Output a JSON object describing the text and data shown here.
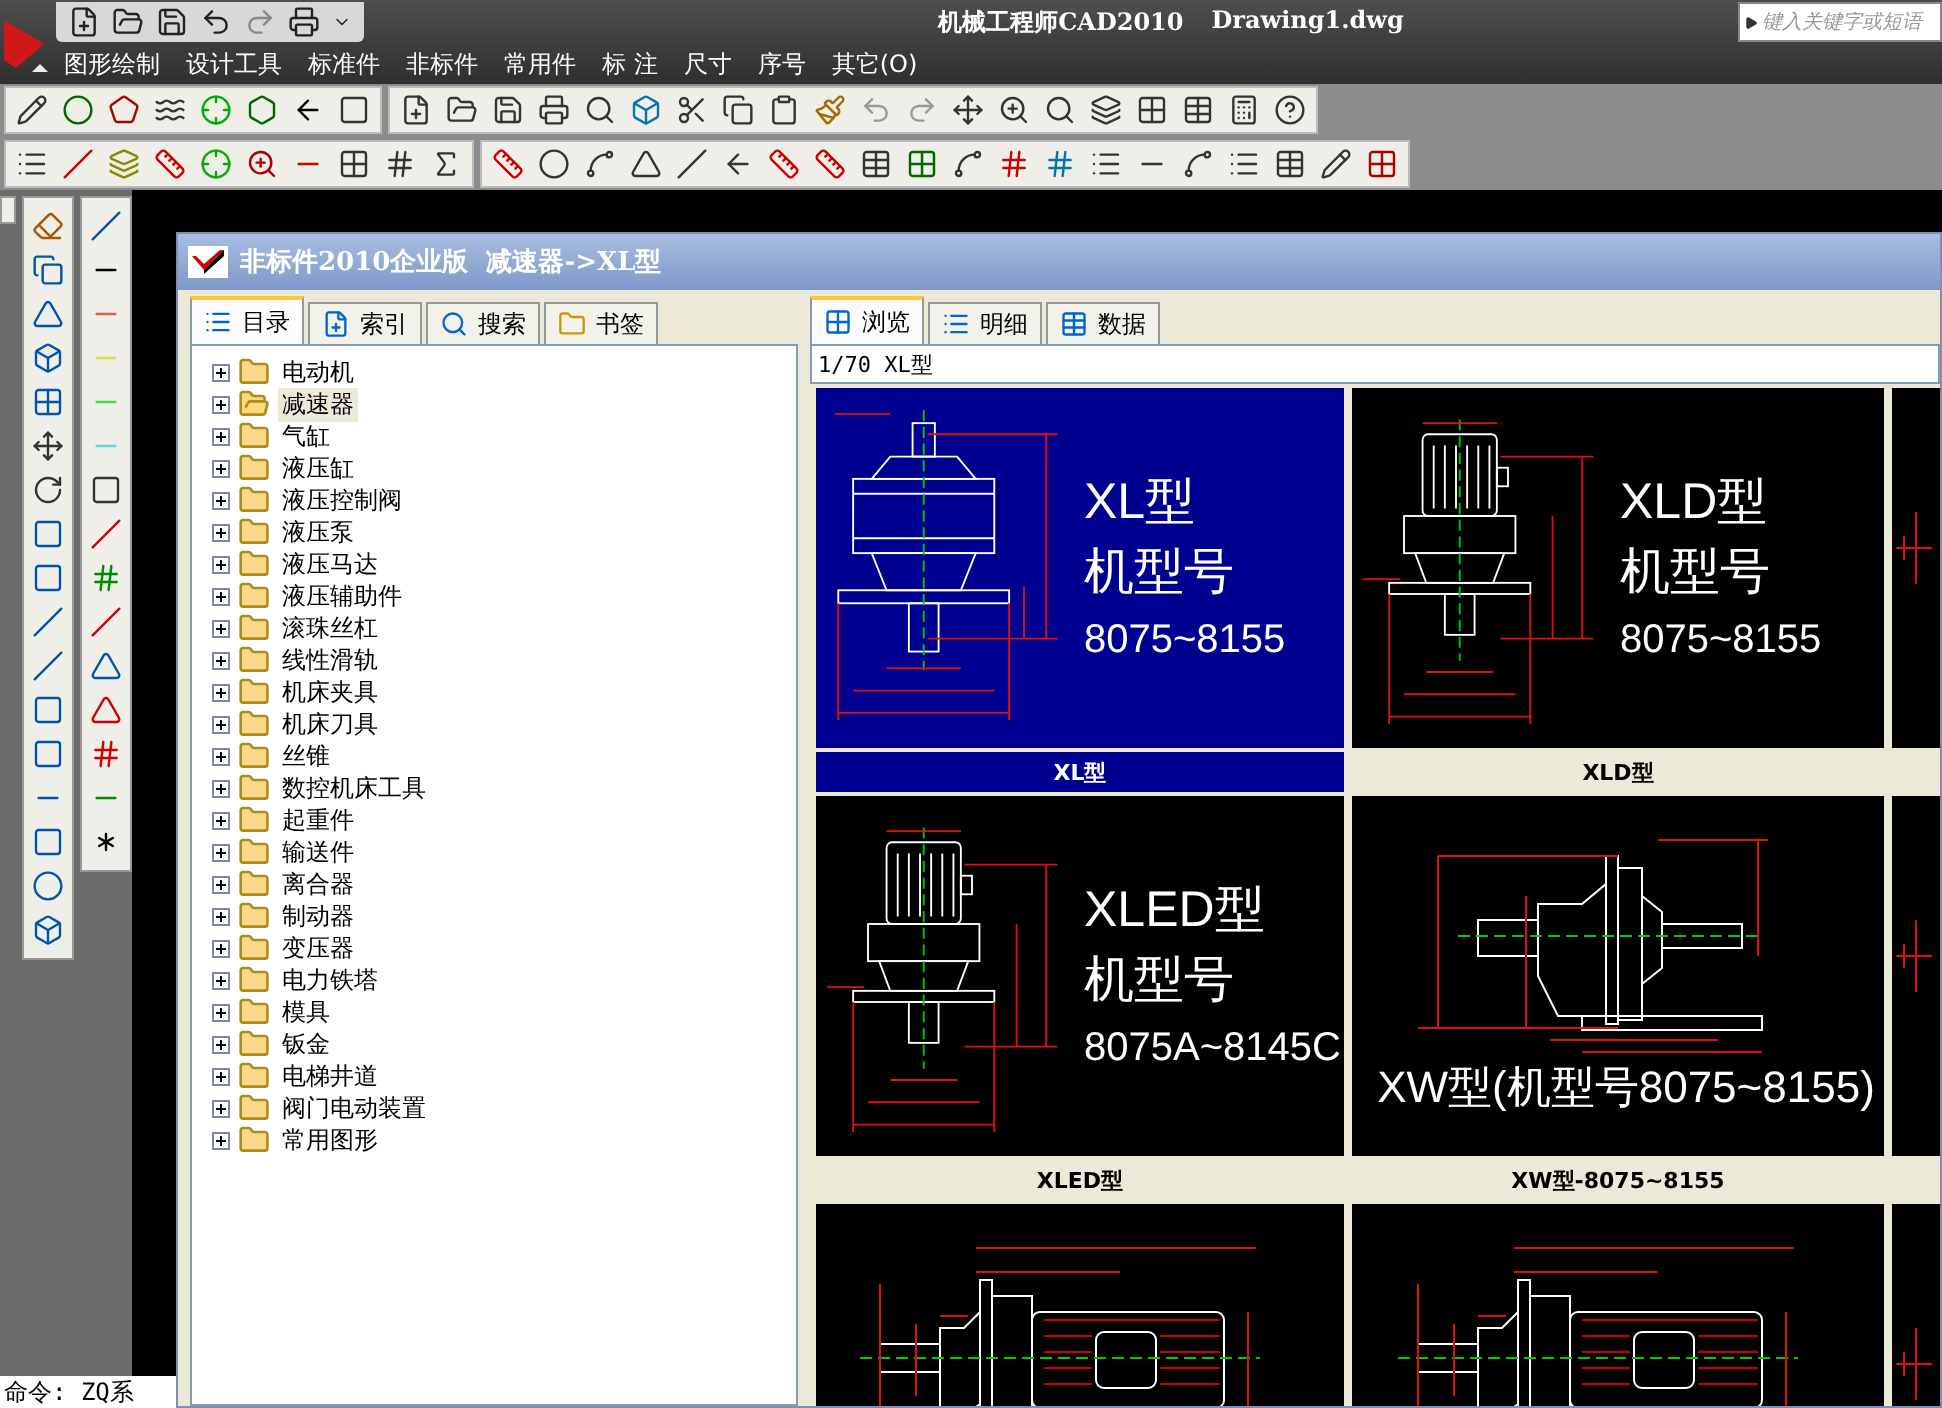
{
  "app": {
    "title": "机械工程师CAD2010",
    "document": "Drawing1.dwg",
    "search": {
      "placeholder": "键入关键字或短语"
    }
  },
  "menu": [
    "图形绘制",
    "设计工具",
    "标准件",
    "非标件",
    "常用件",
    "标 注",
    "尺寸",
    "序号",
    "其它(O)"
  ],
  "command_line": "命令: ZQ系",
  "dialog": {
    "title": "非标件2010企业版  减速器->XL型",
    "left_tabs": [
      {
        "label": "目录",
        "selected": true
      },
      {
        "label": "索引",
        "selected": false
      },
      {
        "label": "搜索",
        "selected": false
      },
      {
        "label": "书签",
        "selected": false
      }
    ],
    "tree": [
      {
        "label": "电动机",
        "selected": false
      },
      {
        "label": "减速器",
        "selected": true
      },
      {
        "label": "气缸",
        "selected": false
      },
      {
        "label": "液压缸",
        "selected": false
      },
      {
        "label": "液压控制阀",
        "selected": false
      },
      {
        "label": "液压泵",
        "selected": false
      },
      {
        "label": "液压马达",
        "selected": false
      },
      {
        "label": "液压辅助件",
        "selected": false
      },
      {
        "label": "滚珠丝杠",
        "selected": false
      },
      {
        "label": "线性滑轨",
        "selected": false
      },
      {
        "label": "机床夹具",
        "selected": false
      },
      {
        "label": "机床刀具",
        "selected": false
      },
      {
        "label": "丝锥",
        "selected": false
      },
      {
        "label": "数控机床工具",
        "selected": false
      },
      {
        "label": "起重件",
        "selected": false
      },
      {
        "label": "输送件",
        "selected": false
      },
      {
        "label": "离合器",
        "selected": false
      },
      {
        "label": "制动器",
        "selected": false
      },
      {
        "label": "变压器",
        "selected": false
      },
      {
        "label": "电力铁塔",
        "selected": false
      },
      {
        "label": "模具",
        "selected": false
      },
      {
        "label": "钣金",
        "selected": false
      },
      {
        "label": "电梯井道",
        "selected": false
      },
      {
        "label": "阀门电动装置",
        "selected": false
      },
      {
        "label": "常用图形",
        "selected": false
      }
    ],
    "right_tabs": [
      {
        "label": "浏览",
        "selected": true
      },
      {
        "label": "明细",
        "selected": false
      },
      {
        "label": "数据",
        "selected": false
      }
    ],
    "path": "1/70 XL型",
    "thumbnails": [
      {
        "kind": "vertical",
        "selected": true,
        "caption": "XL型",
        "lines": [
          "XL型",
          "机型号",
          "8075~8155"
        ]
      },
      {
        "kind": "motor-vertical",
        "selected": false,
        "caption": "XLD型",
        "lines": [
          "XLD型",
          "机型号",
          "8075~8155"
        ]
      },
      {
        "kind": "edge",
        "selected": false
      },
      {
        "kind": "motor-vertical",
        "selected": false,
        "caption": "XLED型",
        "lines": [
          "XLED型",
          "机型号",
          "8075A~8145C"
        ]
      },
      {
        "kind": "horizontal",
        "selected": false,
        "caption": "XW型-8075~8155",
        "lines": [
          "XW型(机型号8075~8155)"
        ]
      },
      {
        "kind": "edge",
        "selected": false
      },
      {
        "kind": "horizontal-motor",
        "selected": false
      },
      {
        "kind": "horizontal-motor",
        "selected": false
      },
      {
        "kind": "edge",
        "selected": false
      }
    ]
  }
}
